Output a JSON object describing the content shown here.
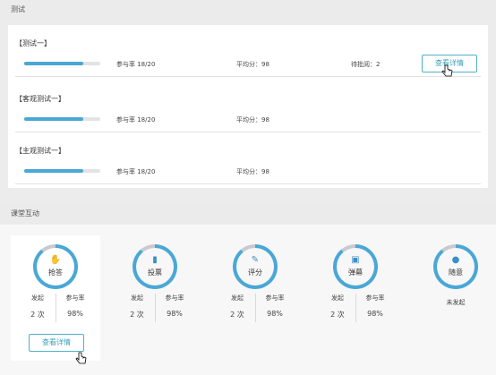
{
  "sections": {
    "test_title": "测试",
    "class_title": "课堂互动"
  },
  "tests": [
    {
      "name": "【测试一】",
      "rate": "参与率 18/20",
      "progress": 0.78,
      "avg": "平均分：98",
      "pending": "待批阅：2",
      "button": "查看详情"
    },
    {
      "name": "【客观测试一】",
      "rate": "参与率 18/20",
      "progress": 0.78,
      "avg": "平均分：98"
    },
    {
      "name": "【主观测试一】",
      "rate": "参与率 18/20",
      "progress": 0.78,
      "avg": "平均分：98"
    }
  ],
  "activities": [
    {
      "label": "抢答",
      "icon": "hand-icon",
      "glyph": "✋",
      "k1": "发起",
      "v1": "2 次",
      "k2": "参与率",
      "v2": "98%",
      "button": "查看详情",
      "ring_progress": 0.89
    },
    {
      "label": "投票",
      "icon": "bar-chart-icon",
      "glyph": "▮",
      "k1": "发起",
      "v1": "2 次",
      "k2": "参与率",
      "v2": "98%",
      "ring_progress": 0.89
    },
    {
      "label": "评分",
      "icon": "edit-icon",
      "glyph": "✎",
      "k1": "发起",
      "v1": "2 次",
      "k2": "参与率",
      "v2": "98%",
      "ring_progress": 0.89
    },
    {
      "label": "弹幕",
      "icon": "message-icon",
      "glyph": "▣",
      "k1": "发起",
      "v1": "2 次",
      "k2": "参与率",
      "v2": "98%",
      "ring_progress": 0.89
    },
    {
      "label": "随意",
      "icon": "shuffle-icon",
      "glyph": "●",
      "status": "未发起",
      "ring_progress": 0.89
    }
  ],
  "colors": {
    "accent": "#4aa7d6",
    "button": "#3aa0b8"
  }
}
